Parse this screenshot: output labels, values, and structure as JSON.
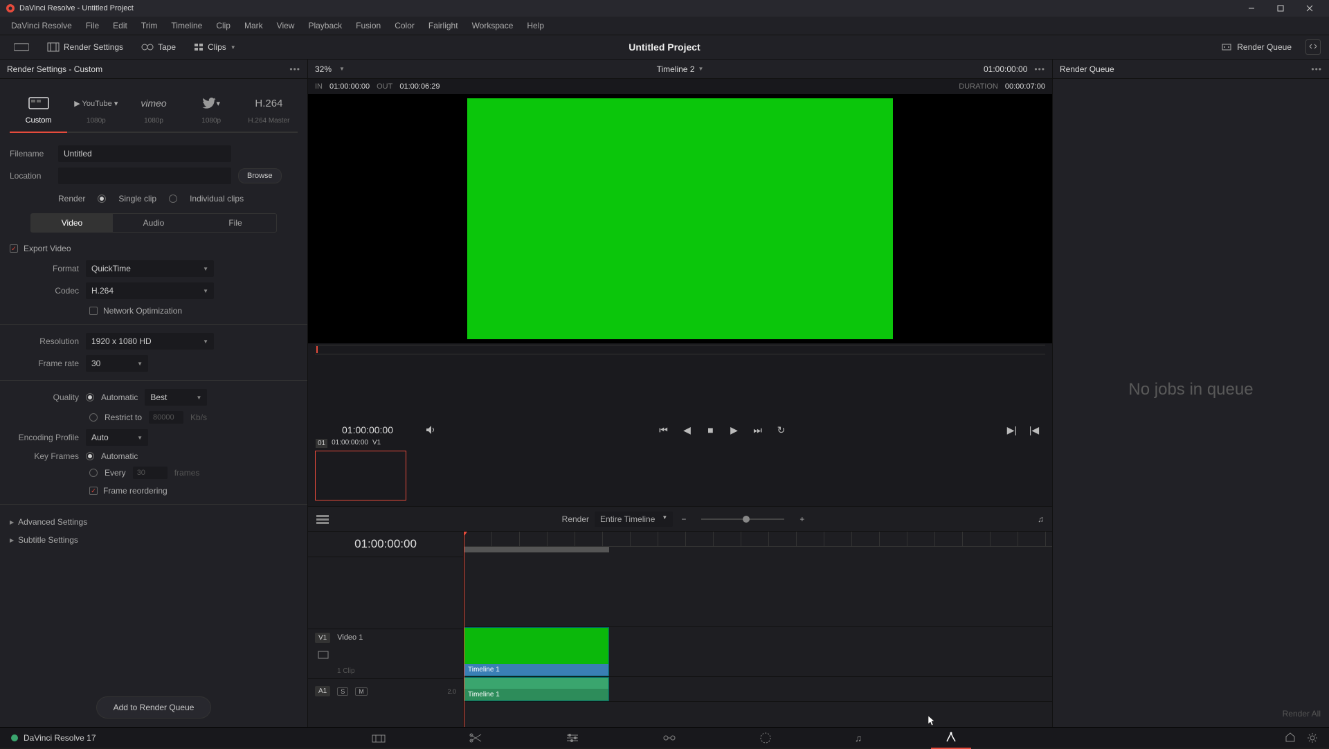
{
  "window": {
    "title": "DaVinci Resolve - Untitled Project"
  },
  "menubar": {
    "items": [
      "DaVinci Resolve",
      "File",
      "Edit",
      "Trim",
      "Timeline",
      "Clip",
      "Mark",
      "View",
      "Playback",
      "Fusion",
      "Color",
      "Fairlight",
      "Workspace",
      "Help"
    ]
  },
  "toolbar": {
    "render_settings": "Render Settings",
    "tape": "Tape",
    "clips": "Clips",
    "project_title": "Untitled Project",
    "render_queue": "Render Queue"
  },
  "render_settings": {
    "title": "Render Settings - Custom",
    "presets": [
      {
        "label": "Custom",
        "sub": ""
      },
      {
        "label": "YouTube",
        "sub": "1080p"
      },
      {
        "label": "vimeo",
        "sub": "1080p"
      },
      {
        "label": "Twitter",
        "sub": "1080p"
      },
      {
        "label": "H.264",
        "sub": "H.264 Master"
      }
    ],
    "active_preset": 0,
    "filename_label": "Filename",
    "filename_value": "Untitled",
    "location_label": "Location",
    "location_value": "",
    "browse": "Browse",
    "render_label": "Render",
    "single_clip": "Single clip",
    "individual_clips": "Individual clips",
    "tabs": [
      "Video",
      "Audio",
      "File"
    ],
    "active_tab": 0,
    "export_video": "Export Video",
    "format_label": "Format",
    "format_value": "QuickTime",
    "codec_label": "Codec",
    "codec_value": "H.264",
    "network_opt": "Network Optimization",
    "resolution_label": "Resolution",
    "resolution_value": "1920 x 1080 HD",
    "frame_rate_label": "Frame rate",
    "frame_rate_value": "30",
    "quality_label": "Quality",
    "quality_auto": "Automatic",
    "quality_best": "Best",
    "restrict_to": "Restrict to",
    "restrict_val": "80000",
    "restrict_unit": "Kb/s",
    "encoding_profile_label": "Encoding Profile",
    "encoding_profile_value": "Auto",
    "key_frames_label": "Key Frames",
    "key_auto": "Automatic",
    "key_every": "Every",
    "key_val": "30",
    "key_unit": "frames",
    "frame_reordering": "Frame reordering",
    "advanced": "Advanced Settings",
    "subtitle": "Subtitle Settings",
    "add_to_queue": "Add to Render Queue"
  },
  "viewer": {
    "timeline_name": "Timeline 2",
    "zoom": "32%",
    "current_tc": "01:00:00:00",
    "in_label": "IN",
    "in_value": "01:00:00:00",
    "out_label": "OUT",
    "out_value": "01:00:06:29",
    "duration_label": "DURATION",
    "duration_value": "00:00:07:00",
    "thumb_idx": "01",
    "thumb_tc": "01:00:00:00",
    "thumb_track": "V1"
  },
  "timeline_tool": {
    "render_label": "Render",
    "render_scope": "Entire Timeline",
    "tc": "01:00:00:00",
    "v1_tag": "V1",
    "v1_name": "Video 1",
    "v1_clips": "1 Clip",
    "a1_tag": "A1",
    "a1_s": "S",
    "a1_m": "M",
    "a1_db": "2.0",
    "clip_v_name": "Timeline 1",
    "clip_a_name": "Timeline 1"
  },
  "queue": {
    "title": "Render Queue",
    "empty": "No jobs in queue",
    "render_all": "Render All"
  },
  "footer": {
    "app": "DaVinci Resolve 17"
  }
}
